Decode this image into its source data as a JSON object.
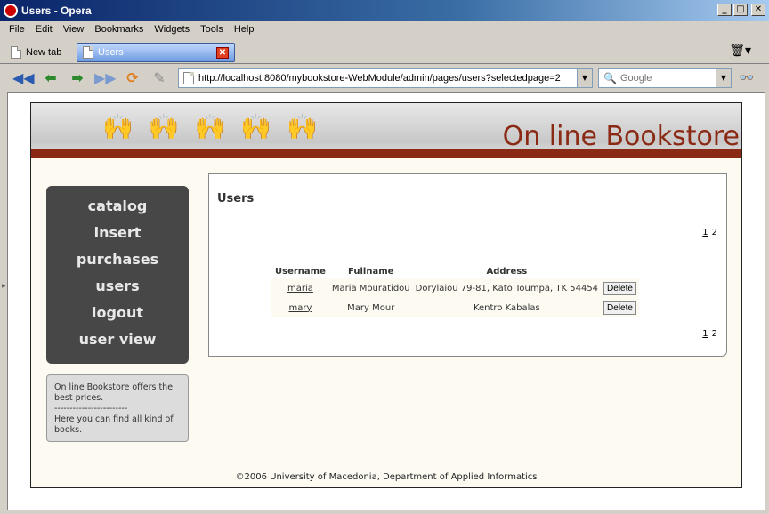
{
  "window": {
    "title": "Users - Opera"
  },
  "menubar": [
    "File",
    "Edit",
    "View",
    "Bookmarks",
    "Widgets",
    "Tools",
    "Help"
  ],
  "tabs": {
    "new_tab": "New tab",
    "active": "Users"
  },
  "address": {
    "url": "http://localhost:8080/mybookstore-WebModule/admin/pages/users?selectedpage=2"
  },
  "search": {
    "placeholder": "Google"
  },
  "site": {
    "brand": "On line Bookstore",
    "menu": [
      "catalog",
      "insert",
      "purchases",
      "users",
      "logout",
      "user view"
    ],
    "info": {
      "line1": "On line Bookstore offers the best prices.",
      "sep": "------------------------",
      "line2": "Here you can find all kind of books."
    },
    "footer": "©2006 University of Macedonia, Department of Applied Informatics"
  },
  "content": {
    "title": "Users",
    "pages": [
      "1",
      "2"
    ],
    "columns": [
      "Username",
      "Fullname",
      "Address"
    ],
    "rows": [
      {
        "username": "maria",
        "fullname": "Maria Mouratidou",
        "address": "Dorylaiou 79-81, Kato Toumpa, TK 54454",
        "action": "Delete"
      },
      {
        "username": "mary",
        "fullname": "Mary Mour",
        "address": "Kentro Kabalas",
        "action": "Delete"
      }
    ]
  }
}
